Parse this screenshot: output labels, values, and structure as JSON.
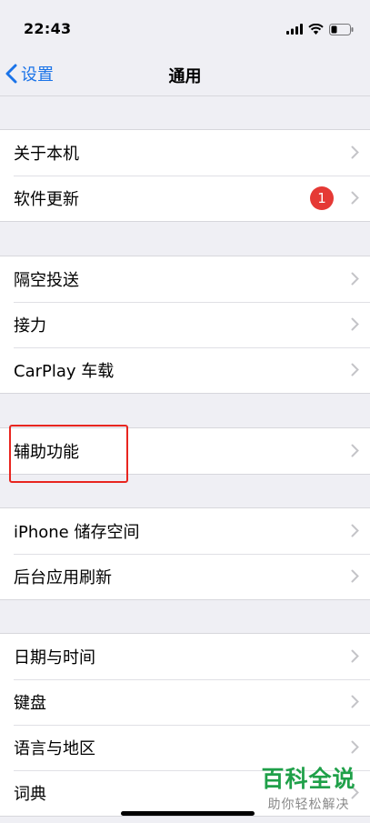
{
  "status_bar": {
    "time": "22:43"
  },
  "nav": {
    "back_label": "设置",
    "title": "通用"
  },
  "groups": [
    {
      "items": [
        {
          "label": "关于本机"
        },
        {
          "label": "软件更新",
          "badge": "1"
        }
      ]
    },
    {
      "items": [
        {
          "label": "隔空投送"
        },
        {
          "label": "接力"
        },
        {
          "label": "CarPlay 车载"
        }
      ]
    },
    {
      "items": [
        {
          "label": "辅助功能"
        }
      ]
    },
    {
      "items": [
        {
          "label": "iPhone 储存空间"
        },
        {
          "label": "后台应用刷新"
        }
      ]
    },
    {
      "items": [
        {
          "label": "日期与时间"
        },
        {
          "label": "键盘"
        },
        {
          "label": "语言与地区"
        },
        {
          "label": "词典"
        }
      ]
    }
  ],
  "watermark": {
    "title": "百科全说",
    "subtitle": "助你轻松解决"
  },
  "colors": {
    "accent": "#1a73e8",
    "badge": "#e53935",
    "highlight": "#e8251f",
    "watermark": "#1fa049"
  }
}
